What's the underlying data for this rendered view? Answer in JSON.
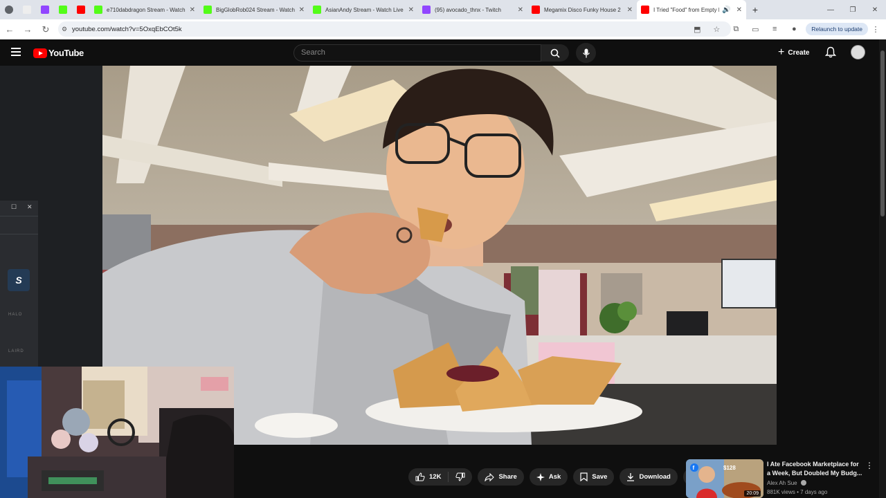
{
  "browser": {
    "tabs": [
      {
        "icon": "chrome-settings-icon",
        "color": "#5f6368",
        "label": ""
      },
      {
        "icon": "blank-tab-icon",
        "color": "#eeeeee",
        "label": ""
      },
      {
        "icon": "twitch-icon",
        "color": "#9146ff",
        "label": ""
      },
      {
        "icon": "kick-icon",
        "color": "#53fc18",
        "label": ""
      },
      {
        "icon": "youtube-icon",
        "color": "#ff0000",
        "label": ""
      }
    ],
    "named_tabs": [
      {
        "icon": "kick-icon",
        "color": "#53fc18",
        "label": "e710dabdragon Stream - Watch"
      },
      {
        "icon": "kick-icon",
        "color": "#53fc18",
        "label": "BigGlobRob024 Stream - Watch"
      },
      {
        "icon": "kick-icon",
        "color": "#53fc18",
        "label": "AsianAndy Stream - Watch Live"
      },
      {
        "icon": "twitch-icon",
        "color": "#9146ff",
        "label": "(95) avocado_thnx - Twitch"
      },
      {
        "icon": "youtube-icon",
        "color": "#ff0000",
        "label": "Megamix Disco Funky House 2"
      },
      {
        "icon": "youtube-icon",
        "color": "#ff0000",
        "label": "I Tried \"Food\" from Empty R"
      }
    ],
    "url": "youtube.com/watch?v=5OxqEbCOt5k",
    "relaunch_label": "Relaunch to update"
  },
  "youtube": {
    "logo_text": "YouTube",
    "search_placeholder": "Search",
    "create_label": "Create",
    "actions": {
      "like_count": "12K",
      "share": "Share",
      "ask": "Ask",
      "save": "Save",
      "download": "Download"
    },
    "recommendation": {
      "title": "I Ate Facebook Marketplace for a Week, But Doubled My Budg...",
      "channel": "Alex Ah Sue",
      "views": "881K views",
      "age": "7 days ago",
      "meta_sep": " • ",
      "duration": "20:09",
      "thumb_price": "$128"
    }
  },
  "sidebar": {
    "app_tile_letter": "S",
    "labels": [
      "HALO",
      "LAIRD"
    ]
  },
  "colors": {
    "youtube_red": "#ff0000",
    "page_bg": "#0f0f0f",
    "pill_bg": "#272727"
  }
}
